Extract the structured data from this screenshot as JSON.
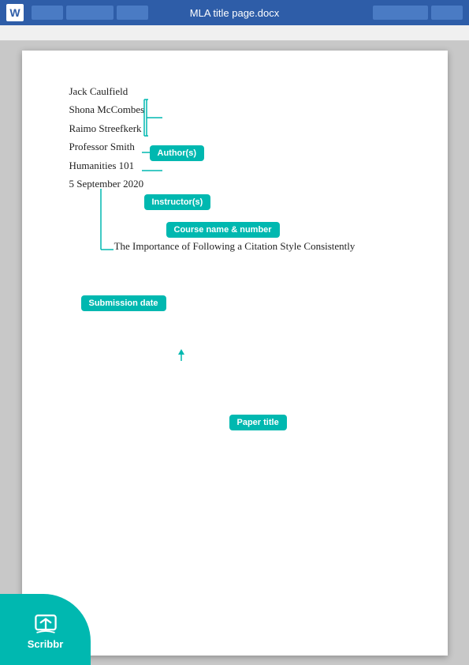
{
  "titlebar": {
    "title": "MLA title page.docx",
    "word_icon": "W",
    "buttons_left": [
      "btn1",
      "btn2",
      "btn3"
    ],
    "buttons_right": [
      "btn4",
      "btn5"
    ]
  },
  "document": {
    "authors": [
      "Jack Caulfield",
      "Shona McCombes",
      "Raimo Streefkerk"
    ],
    "instructor": "Professor Smith",
    "course": "Humanities 101",
    "date": "5 September 2020",
    "paper_title": "The Importance of Following a Citation Style Consistently"
  },
  "annotations": {
    "authors_label": "Author(s)",
    "instructor_label": "Instructor(s)",
    "course_label": "Course name & number",
    "date_label": "Submission date",
    "title_label": "Paper title"
  },
  "scribbr": {
    "name": "Scribbr"
  }
}
